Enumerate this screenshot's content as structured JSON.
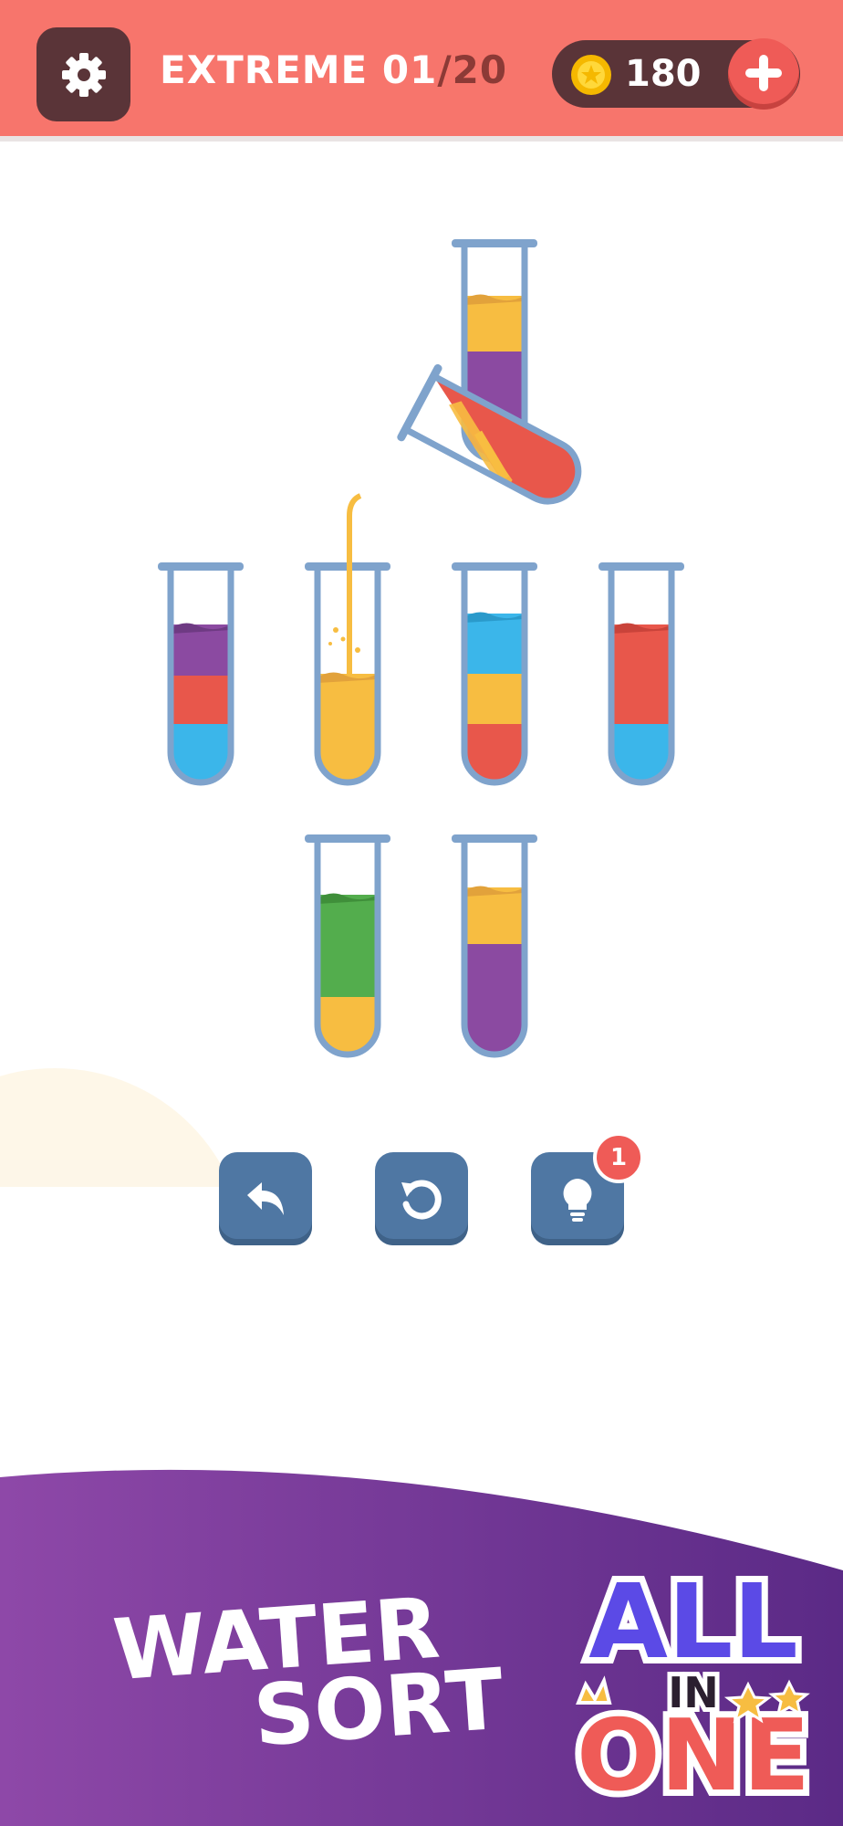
{
  "header": {
    "settings_icon": "gear-icon",
    "level_label": "EXTREME 01",
    "level_total": "/20",
    "coins": "180",
    "add_coins_icon": "plus-icon"
  },
  "controls": {
    "undo_icon": "undo-icon",
    "restart_icon": "restart-icon",
    "hint_icon": "lightbulb-icon",
    "hint_count": "1"
  },
  "banner": {
    "title_line1": "WATER",
    "title_line2": "SORT",
    "logo_all": "ALL",
    "logo_in": "IN",
    "logo_one": "ONE"
  },
  "colors": {
    "header": "#f7756c",
    "purple": "#8b4aa1",
    "yellow": "#f7bd41",
    "red": "#e8574b",
    "blue": "#3bb6ea",
    "green": "#53ad4d",
    "tube_outline": "#7fa3cc",
    "button": "#4f77a3"
  },
  "tubes": [
    {
      "layers": [
        "purple",
        "yellow"
      ]
    },
    {
      "layers": [
        "blue",
        "red",
        "purple"
      ]
    },
    {
      "layers": [
        "yellow"
      ]
    },
    {
      "layers": [
        "red",
        "yellow",
        "blue"
      ]
    },
    {
      "layers": [
        "blue",
        "red"
      ]
    },
    {
      "layers": [
        "yellow",
        "green"
      ]
    },
    {
      "layers": [
        "purple",
        "yellow"
      ]
    }
  ],
  "pouring_tube": {
    "layers": [
      "red",
      "yellow"
    ]
  }
}
